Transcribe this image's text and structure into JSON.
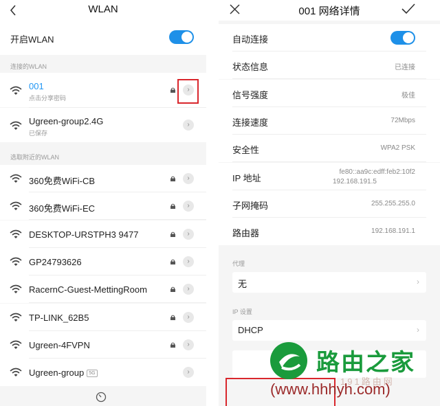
{
  "left": {
    "title": "WLAN",
    "enable_label": "开启WLAN",
    "connected_header": "连接的WLAN",
    "connected": [
      {
        "name": "001",
        "sub": "点击分享密码",
        "locked": true,
        "active": true
      },
      {
        "name": "Ugreen-group2.4G",
        "sub": "已保存",
        "locked": false,
        "active": false
      }
    ],
    "nearby_header": "选取附近的WLAN",
    "nearby": [
      {
        "name": "360免费WiFi-CB",
        "locked": true
      },
      {
        "name": "360免费WiFi-EC",
        "locked": true
      },
      {
        "name": "DESKTOP-URSTPH3 9477",
        "locked": true
      },
      {
        "name": "GP24793626",
        "locked": true
      },
      {
        "name": "RacernC-Guest-MettingRoom",
        "locked": true
      },
      {
        "name": "TP-LINK_62B5",
        "locked": true
      },
      {
        "name": "Ugreen-4FVPN",
        "locked": true
      },
      {
        "name": "Ugreen-group",
        "badge": "5G",
        "locked": false
      }
    ]
  },
  "right": {
    "title": "001  网络详情",
    "rows": [
      {
        "label": "自动连接",
        "value": ""
      },
      {
        "label": "状态信息",
        "value": "已连接"
      },
      {
        "label": "信号强度",
        "value": "极佳"
      },
      {
        "label": "连接速度",
        "value": "72Mbps"
      },
      {
        "label": "安全性",
        "value": "WPA2 PSK"
      },
      {
        "label": "IP 地址",
        "value": "fe80::aa9c:edff:feb2:10f2",
        "value2": "192.168.191.5"
      },
      {
        "label": "子网掩码",
        "value": "255.255.255.0"
      },
      {
        "label": "路由器",
        "value": "192.168.191.1"
      }
    ],
    "proxy_header": "代理",
    "proxy_value": "无",
    "ip_header": "IP 设置",
    "ip_value": "DHCP"
  },
  "watermark": {
    "title": "路由之家",
    "sub": "191路由网",
    "url": "(www.hhhyh.com)"
  },
  "colors": {
    "accent": "#1e90e8",
    "highlight": "#d9262c",
    "active_text": "#2196f3"
  }
}
